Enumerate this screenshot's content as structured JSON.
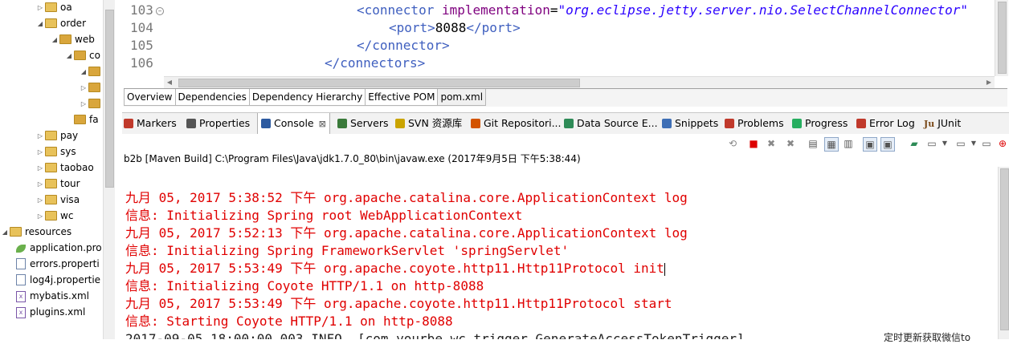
{
  "tree": {
    "items": [
      {
        "label": "oa",
        "type": "folder",
        "twisty": "▷"
      },
      {
        "label": "order",
        "type": "folder",
        "twisty": "◢"
      },
      {
        "label": "web",
        "type": "folder",
        "twisty": "◢"
      },
      {
        "label": "co",
        "type": "folder",
        "twisty": "◢"
      },
      {
        "label": "",
        "type": "folder",
        "twisty": "◢"
      },
      {
        "label": "",
        "type": "folder",
        "twisty": "▷"
      },
      {
        "label": "",
        "type": "folder",
        "twisty": "▷"
      },
      {
        "label": "fa",
        "type": "folder",
        "twisty": ""
      },
      {
        "label": "pay",
        "type": "folder",
        "twisty": "▷"
      },
      {
        "label": "sys",
        "type": "folder",
        "twisty": "▷"
      },
      {
        "label": "taobao",
        "type": "folder",
        "twisty": "▷"
      },
      {
        "label": "tour",
        "type": "folder",
        "twisty": "▷"
      },
      {
        "label": "visa",
        "type": "folder",
        "twisty": "▷"
      },
      {
        "label": "wc",
        "type": "folder",
        "twisty": "▷"
      },
      {
        "label": "resources",
        "type": "folder",
        "twisty": "◢"
      },
      {
        "label": "application.pro",
        "type": "leaf",
        "twisty": ""
      },
      {
        "label": "errors.properti",
        "type": "file",
        "twisty": ""
      },
      {
        "label": "log4j.propertie",
        "type": "file",
        "twisty": ""
      },
      {
        "label": "mybatis.xml",
        "type": "xml",
        "twisty": ""
      },
      {
        "label": "plugins.xml",
        "type": "xml",
        "twisty": ""
      }
    ]
  },
  "editor": {
    "lines": [
      {
        "num": "103",
        "fold": "⊖",
        "tagOpen": "<connector ",
        "attr": "implementation",
        "eq": "=",
        "value": "\"org.eclipse.jetty.server.nio.SelectChannelConnector\"",
        "rest": ""
      },
      {
        "num": "104",
        "open": "<port>",
        "text": "8088",
        "close": "</port>"
      },
      {
        "num": "105",
        "close": "</connector>"
      },
      {
        "num": "106",
        "close": "</connectors>"
      }
    ]
  },
  "pom_tabs": [
    "Overview",
    "Dependencies",
    "Dependency Hierarchy",
    "Effective POM",
    "pom.xml"
  ],
  "view_tabs": [
    {
      "label": "Markers",
      "icon": "markers-icon",
      "color": "#c0392b"
    },
    {
      "label": "Properties",
      "icon": "properties-icon",
      "color": "#555555"
    },
    {
      "label": "Console",
      "icon": "console-icon",
      "color": "#2c5aa0",
      "active": true,
      "close": "⊠"
    },
    {
      "label": "Servers",
      "icon": "servers-icon",
      "color": "#3a7a3a"
    },
    {
      "label": "SVN 资源库",
      "icon": "svn-icon",
      "color": "#caa400"
    },
    {
      "label": "Git Repositori...",
      "icon": "git-icon",
      "color": "#d35400"
    },
    {
      "label": "Data Source E...",
      "icon": "datasource-icon",
      "color": "#2e8b57"
    },
    {
      "label": "Snippets",
      "icon": "snippets-icon",
      "color": "#3f6fb5"
    },
    {
      "label": "Problems",
      "icon": "problems-icon",
      "color": "#c0392b"
    },
    {
      "label": "Progress",
      "icon": "progress-icon",
      "color": "#27ae60"
    },
    {
      "label": "Error Log",
      "icon": "errorlog-icon",
      "color": "#c0392b"
    },
    {
      "label": "JUnit",
      "icon": "junit-icon",
      "color": "#7a4a1a",
      "prefix": "Ju"
    }
  ],
  "console": {
    "header": "b2b [Maven Build] C:\\Program Files\\Java\\jdk1.7.0_80\\bin\\javaw.exe (2017年9月5日 下午5:38:44)",
    "lines": [
      "九月 05, 2017 5:38:52 下午 org.apache.catalina.core.ApplicationContext log",
      "信息: Initializing Spring root WebApplicationContext",
      "九月 05, 2017 5:52:13 下午 org.apache.catalina.core.ApplicationContext log",
      "信息: Initializing Spring FrameworkServlet 'springServlet'",
      "九月 05, 2017 5:53:49 下午 org.apache.coyote.http11.Http11Protocol init",
      "信息: Initializing Coyote HTTP/1.1 on http-8088",
      "九月 05, 2017 5:53:49 下午 org.apache.coyote.http11.Http11Protocol start",
      "信息: Starting Coyote HTTP/1.1 on http-8088",
      "2017-09-05 18:00:00.003 INFO  [com.yourbe.wc.trigger.GenerateAccessTokenTrigger]"
    ],
    "right_text": "定时更新获取微信to"
  }
}
